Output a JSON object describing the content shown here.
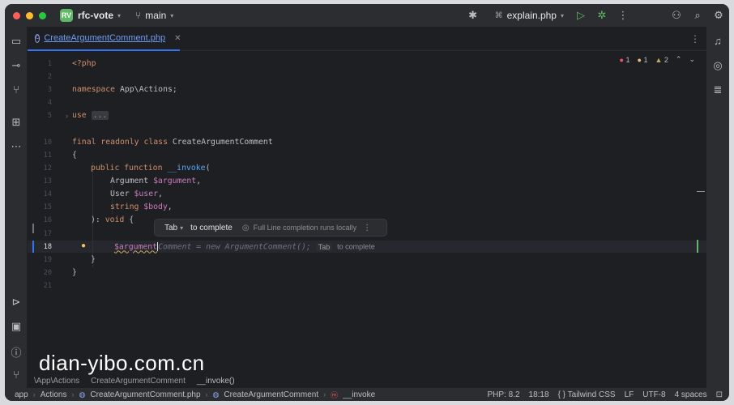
{
  "titlebar": {
    "project_badge": "RV",
    "project_name": "rfc-vote",
    "branch": "main",
    "run_config": "explain.php",
    "traffic_lights": [
      "#ff5f57",
      "#febc2e",
      "#28c840"
    ]
  },
  "tab": {
    "label": "CreateArgumentComment.php"
  },
  "inspections": {
    "errors": "1",
    "warnings": "1",
    "weak_warnings": "2"
  },
  "gutter": [
    "1",
    "2",
    "3",
    "4",
    "5",
    "10",
    "11",
    "12",
    "13",
    "14",
    "15",
    "16",
    "17",
    "18",
    "19",
    "20",
    "21"
  ],
  "code": {
    "l1": "<?php",
    "l3_kw": "namespace",
    "l3_rest": " App\\Actions;",
    "l5_kw": "use",
    "l5_fold": "...",
    "l10_kw1": "final readonly class",
    "l10_rest": " CreateArgumentComment",
    "l11": "{",
    "l12_kw": "public function",
    "l12_fn": " __invoke",
    "l12_paren": "(",
    "l13_type": "Argument ",
    "l13_var": "$argument",
    "l13_comma": ",",
    "l14_type": "User ",
    "l14_var": "$user",
    "l14_comma": ",",
    "l15_type": "string ",
    "l15_var": "$body",
    "l15_comma": ",",
    "l16_pre": "): ",
    "l16_kw": "void",
    "l16_post": " {",
    "l18_var": "$argument",
    "l18_ghost": "Comment = new ArgumentComment();",
    "l18_hint_key": "Tab",
    "l18_hint_text": "to complete",
    "l19": "}",
    "l20": "}"
  },
  "completion_popup": {
    "key": "Tab",
    "action": "to complete",
    "info": "Full Line completion runs locally"
  },
  "breadcrumb": {
    "items": [
      "\\App\\Actions",
      "CreateArgumentComment",
      "__invoke()"
    ]
  },
  "statusbar": {
    "path": [
      "app",
      "Actions",
      "CreateArgumentComment.php",
      "CreateArgumentComment",
      "__invoke"
    ],
    "php": "PHP: 8.2",
    "position": "18:18",
    "framework": "Tailwind CSS",
    "line_sep": "LF",
    "encoding": "UTF-8",
    "indent": "4 spaces"
  },
  "watermark": "dian-yibo.com.cn"
}
